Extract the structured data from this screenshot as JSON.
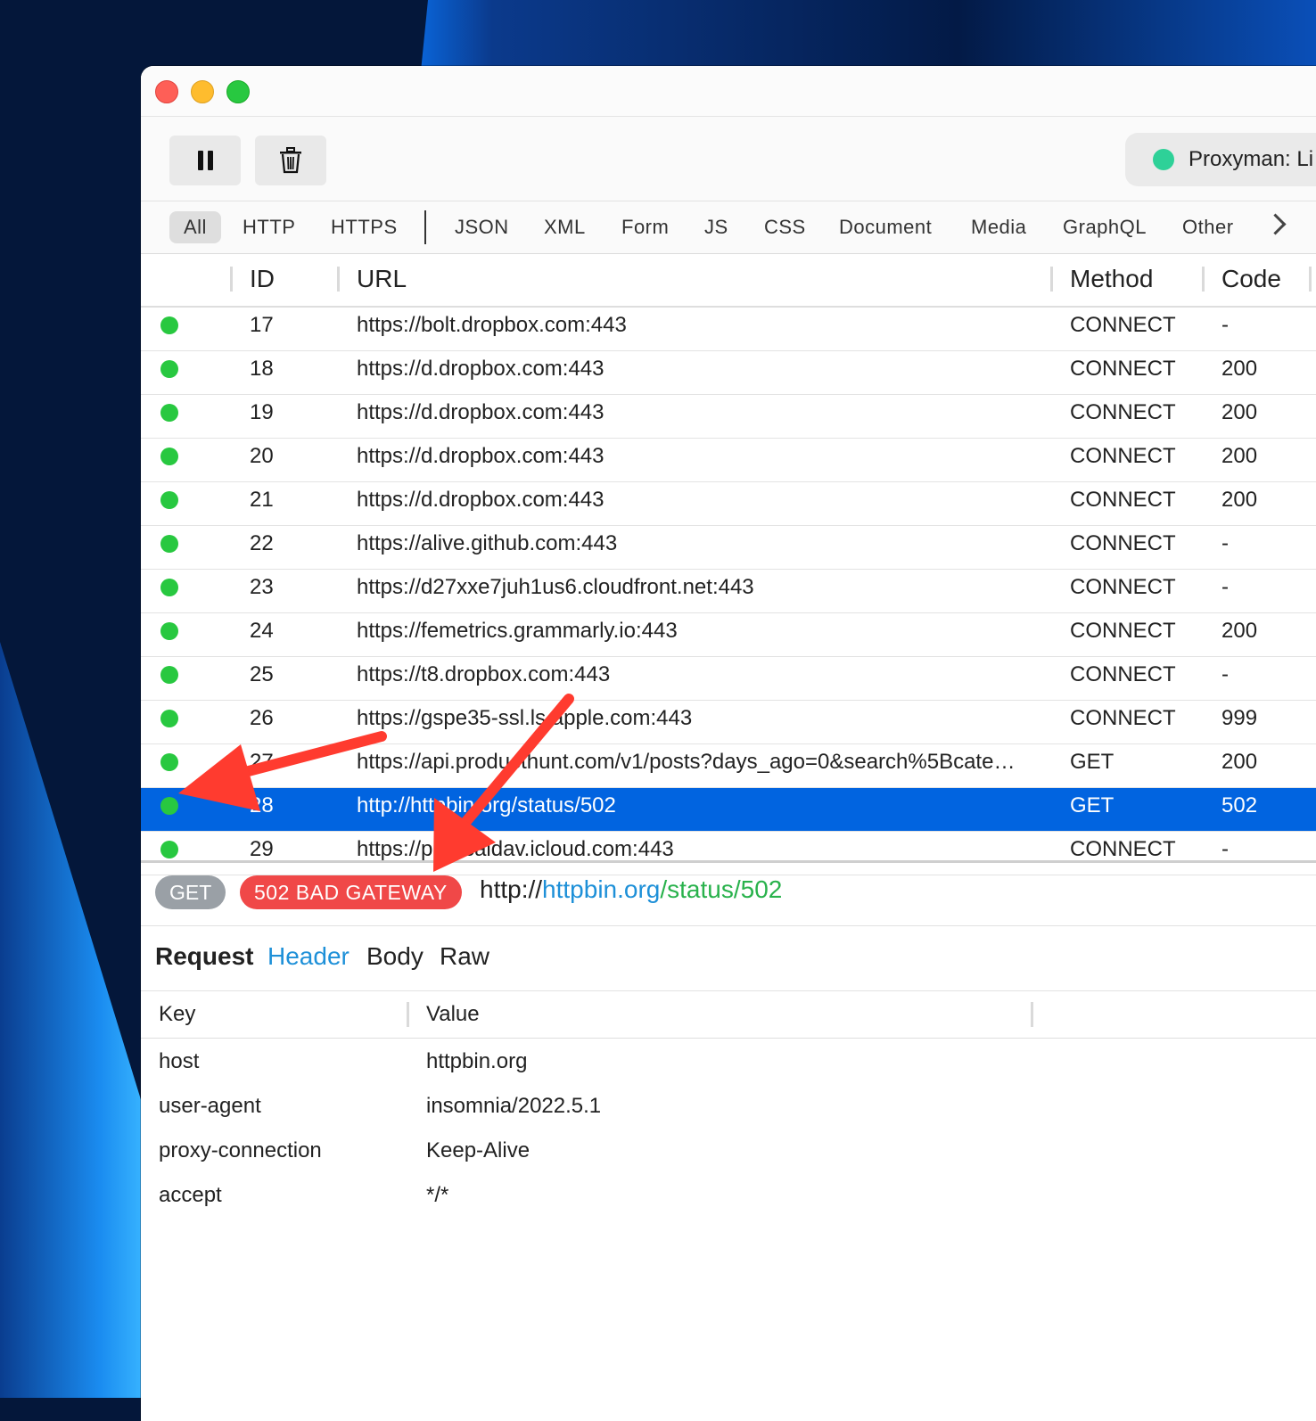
{
  "colors": {
    "accent_blue": "#0164e0",
    "status_green": "#28c840",
    "proxyman_green": "#2ed198",
    "error_red": "#f04848",
    "link_blue": "#1e90d8",
    "path_green": "#29b24c"
  },
  "toolbar": {
    "pause_icon": "pause-icon",
    "trash_icon": "trash-icon",
    "status_label": "Proxyman: Li"
  },
  "filters": [
    "All",
    "HTTP",
    "HTTPS",
    "JSON",
    "XML",
    "Form",
    "JS",
    "CSS",
    "Document",
    "Media",
    "GraphQL",
    "Other"
  ],
  "table": {
    "headers": {
      "id": "ID",
      "url": "URL",
      "method": "Method",
      "code": "Code"
    },
    "rows": [
      {
        "id": "17",
        "url": "https://bolt.dropbox.com:443",
        "method": "CONNECT",
        "code": "-"
      },
      {
        "id": "18",
        "url": "https://d.dropbox.com:443",
        "method": "CONNECT",
        "code": "200"
      },
      {
        "id": "19",
        "url": "https://d.dropbox.com:443",
        "method": "CONNECT",
        "code": "200"
      },
      {
        "id": "20",
        "url": "https://d.dropbox.com:443",
        "method": "CONNECT",
        "code": "200"
      },
      {
        "id": "21",
        "url": "https://d.dropbox.com:443",
        "method": "CONNECT",
        "code": "200"
      },
      {
        "id": "22",
        "url": "https://alive.github.com:443",
        "method": "CONNECT",
        "code": "-"
      },
      {
        "id": "23",
        "url": "https://d27xxe7juh1us6.cloudfront.net:443",
        "method": "CONNECT",
        "code": "-"
      },
      {
        "id": "24",
        "url": "https://femetrics.grammarly.io:443",
        "method": "CONNECT",
        "code": "200"
      },
      {
        "id": "25",
        "url": "https://t8.dropbox.com:443",
        "method": "CONNECT",
        "code": "-"
      },
      {
        "id": "26",
        "url": "https://gspe35-ssl.ls.apple.com:443",
        "method": "CONNECT",
        "code": "999"
      },
      {
        "id": "27",
        "url": "https://api.producthunt.com/v1/posts?days_ago=0&search%5Bcate…",
        "method": "GET",
        "code": "200"
      },
      {
        "id": "28",
        "url": "http://httpbin.org/status/502",
        "method": "GET",
        "code": "502"
      },
      {
        "id": "29",
        "url": "https://p61-caldav.icloud.com:443",
        "method": "CONNECT",
        "code": "-"
      }
    ],
    "selected_index": 11
  },
  "detail": {
    "method": "GET",
    "status": "502 BAD GATEWAY",
    "url_scheme": "http://",
    "url_host": "httpbin.org",
    "url_path": "/status/502"
  },
  "tabs": {
    "title": "Request",
    "items": [
      "Header",
      "Body",
      "Raw"
    ],
    "active": "Header"
  },
  "headers_table": {
    "key_label": "Key",
    "value_label": "Value",
    "rows": [
      {
        "key": "host",
        "value": "httpbin.org"
      },
      {
        "key": "user-agent",
        "value": "insomnia/2022.5.1"
      },
      {
        "key": "proxy-connection",
        "value": "Keep-Alive"
      },
      {
        "key": "accept",
        "value": "*/*"
      }
    ]
  }
}
